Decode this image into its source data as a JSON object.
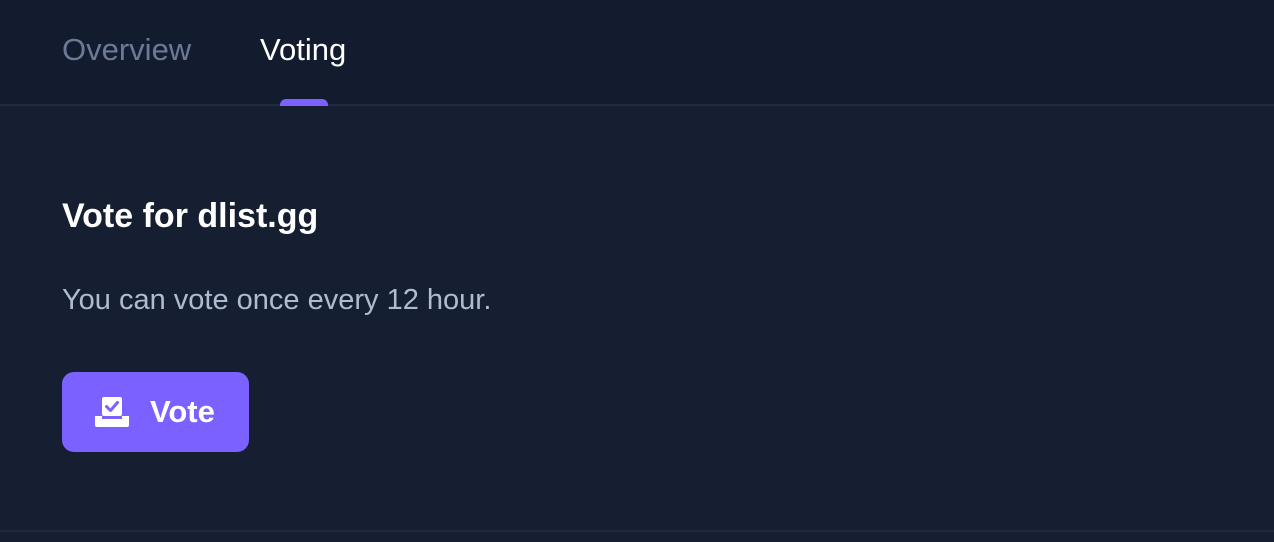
{
  "tabs": [
    {
      "label": "Overview",
      "active": false
    },
    {
      "label": "Voting",
      "active": true
    }
  ],
  "voting": {
    "heading": "Vote for dlist.gg",
    "description": "You can vote once every 12 hour.",
    "button": {
      "label": "Vote",
      "icon": "ballot-box-icon"
    }
  },
  "colors": {
    "accent": "#7b61ff",
    "background": "#161f31",
    "tabbar_background": "#131c2e",
    "inactive_tab_text": "#6b7a96",
    "description_text": "#aebbd2"
  }
}
